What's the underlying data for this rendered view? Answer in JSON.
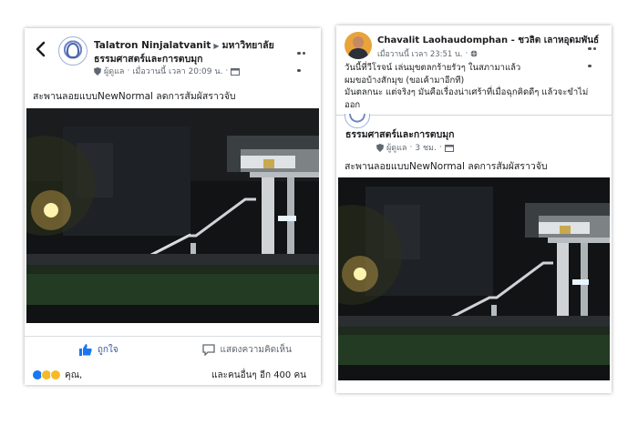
{
  "left_post": {
    "author": "Talatron Ninjalatvanit",
    "arrow": "▶",
    "group_name_line1": "มหาวิทยาลัย",
    "group_name_line2": "ธรรมศาสตร์และการตบมุก",
    "role": "ผู้ดูแล",
    "time": "เมื่อวานนี้ เวลา 20:09 น.",
    "caption": "สะพานลอยแบบNewNormal ลดการสัมผัสราวจับ",
    "like_label": "ถูกใจ",
    "comment_label": "แสดงความคิดเห็น",
    "reactors": "คุณ,",
    "reaction_others": "และคนอื่นๆ อีก 400 คน"
  },
  "right_post": {
    "author": "Chavalit Laohaudomphan - ชวลิต เลาหอุดมพันธ์",
    "time": "เมื่อวานนี้ เวลา 23:51 น.",
    "body_line1": "วันนี้ที่วีโรจน์ เล่นมุขตลกร้ายรัวๆ ในสภามาแล้ว",
    "body_line2": "ผมขอบ้างสักมุข (ขอเค้ามาอีกที)",
    "body_line3": "มันตลกนะ แต่จริงๆ มันคือเรื่องน่าเศร้าที่เมื่อฉุกคิดดีๆ แล้วจะขำไม่",
    "body_line4": "ออก",
    "shared_page": "ธรรมศาสตร์และการตบมุก",
    "shared_role": "ผู้ดูแล",
    "shared_time": "3 ชม.",
    "shared_caption": "สะพานลอยแบบNewNormal ลดการสัมผัสราวจับ"
  },
  "colors": {
    "link_blue": "#385898",
    "text": "#1c1e21",
    "meta_gray": "#606770",
    "fb_blue": "#1877f2"
  },
  "icons": [
    "back-arrow-icon",
    "more-icon",
    "shield-icon",
    "calendar-icon",
    "globe-icon",
    "like-icon",
    "comment-icon"
  ]
}
